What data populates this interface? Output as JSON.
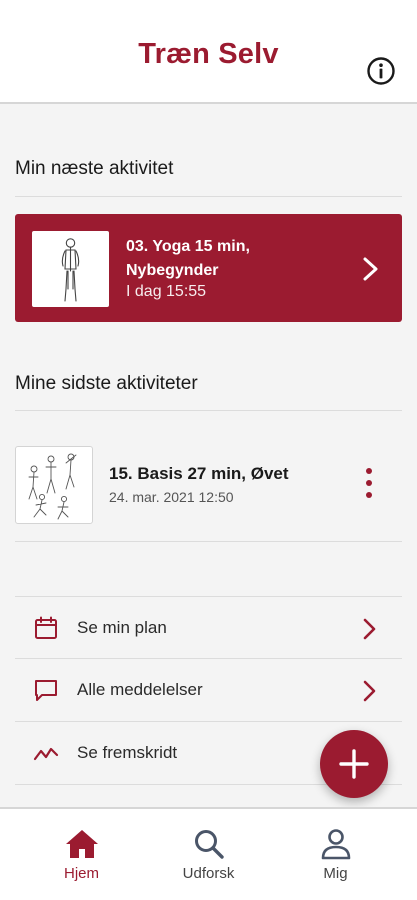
{
  "header": {
    "title": "Træn Selv",
    "info_icon": "info-circle-icon"
  },
  "next_activity": {
    "section_title": "Min næste aktivitet",
    "title": "03. Yoga 15 min, Nybegynder",
    "time": "I dag 15:55",
    "chevron_icon": "chevron-right-icon"
  },
  "recent": {
    "section_title": "Mine sidste aktiviteter",
    "items": [
      {
        "title": "15. Basis 27 min, Øvet",
        "date": "24. mar. 2021 12:50",
        "menu_icon": "more-vertical-icon"
      }
    ]
  },
  "links": [
    {
      "label": "Se min plan",
      "icon": "calendar-icon"
    },
    {
      "label": "Alle meddelelser",
      "icon": "message-icon"
    },
    {
      "label": "Se fremskridt",
      "icon": "trend-icon"
    }
  ],
  "fab": {
    "icon": "plus-icon"
  },
  "tabs": [
    {
      "label": "Hjem",
      "icon": "home-icon",
      "active": true
    },
    {
      "label": "Udforsk",
      "icon": "search-icon",
      "active": false
    },
    {
      "label": "Mig",
      "icon": "person-icon",
      "active": false
    }
  ],
  "colors": {
    "brand": "#9b1b30",
    "background": "#f4f4f4",
    "text": "#1a1a1a"
  }
}
